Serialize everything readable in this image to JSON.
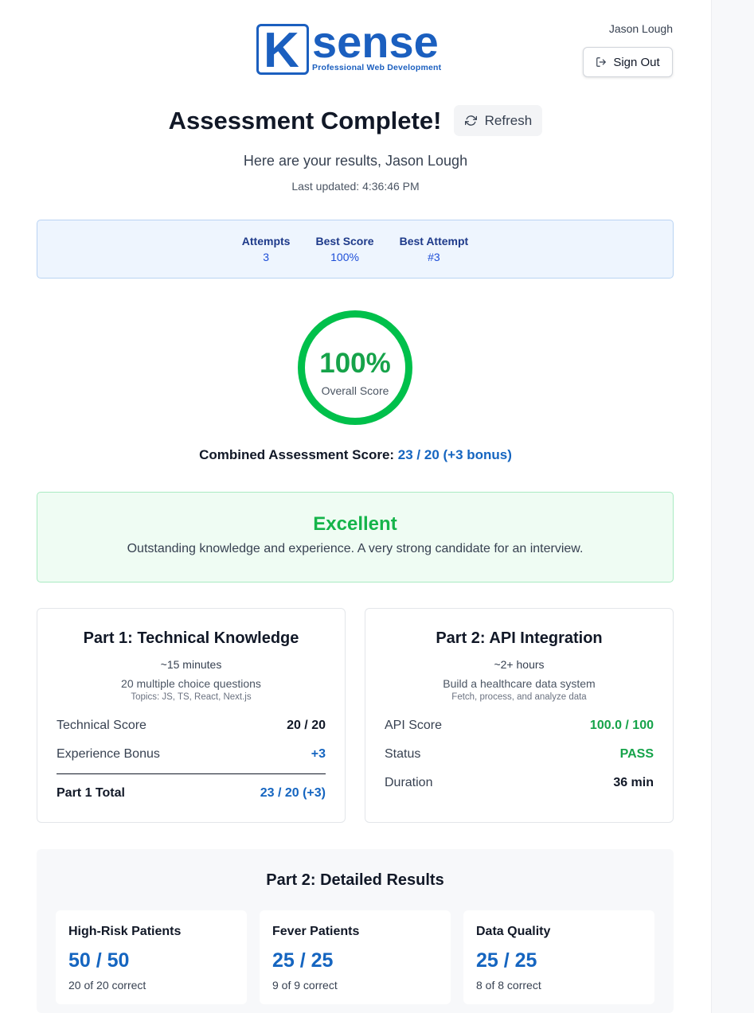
{
  "brand": {
    "letter": "K",
    "word": "sense",
    "tagline": "Professional Web Development",
    "color": "#1b5fbf"
  },
  "header": {
    "user_name": "Jason Lough",
    "sign_out_label": "Sign Out",
    "sign_out_icon": "sign-out-icon"
  },
  "hero": {
    "title": "Assessment Complete!",
    "refresh_label": "Refresh",
    "refresh_icon": "refresh-icon",
    "subtitle": "Here are your results, Jason Lough",
    "last_updated": "Last updated: 4:36:46 PM"
  },
  "stats": [
    {
      "label": "Attempts",
      "value": "3"
    },
    {
      "label": "Best Score",
      "value": "100%"
    },
    {
      "label": "Best Attempt",
      "value": "#3"
    }
  ],
  "overall": {
    "percent_text": "100%",
    "label": "Overall Score",
    "fraction": 1.0,
    "color": "#00c04b"
  },
  "combined": {
    "label": "Combined Assessment Score: ",
    "value": "23 / 20 (+3 bonus)"
  },
  "verdict": {
    "title": "Excellent",
    "text": "Outstanding knowledge and experience. A very strong candidate for an interview."
  },
  "part1": {
    "title": "Part 1: Technical Knowledge",
    "time": "~15 minutes",
    "desc": "20 multiple choice questions",
    "topics": "Topics: JS, TS, React, Next.js",
    "rows": [
      {
        "label": "Technical Score",
        "value": "20 / 20"
      },
      {
        "label": "Experience Bonus",
        "value": "+3"
      }
    ],
    "total": {
      "label": "Part 1 Total",
      "value": "23 / 20 (+3)"
    }
  },
  "part2": {
    "title": "Part 2: API Integration",
    "time": "~2+ hours",
    "desc": "Build a healthcare data system",
    "topics": "Fetch, process, and analyze data",
    "rows": [
      {
        "label": "API Score",
        "value": "100.0 / 100"
      },
      {
        "label": "Status",
        "value": "PASS"
      },
      {
        "label": "Duration",
        "value": "36 min"
      }
    ]
  },
  "details": {
    "title": "Part 2: Detailed Results",
    "cards": [
      {
        "title": "High-Risk Patients",
        "score": "50 / 50",
        "sub": "20 of 20 correct"
      },
      {
        "title": "Fever Patients",
        "score": "25 / 25",
        "sub": "9 of 9 correct"
      },
      {
        "title": "Data Quality",
        "score": "25 / 25",
        "sub": "8 of 8 correct"
      }
    ]
  },
  "colors": {
    "accent_blue": "#1565c0",
    "success_green": "#16a34a"
  }
}
